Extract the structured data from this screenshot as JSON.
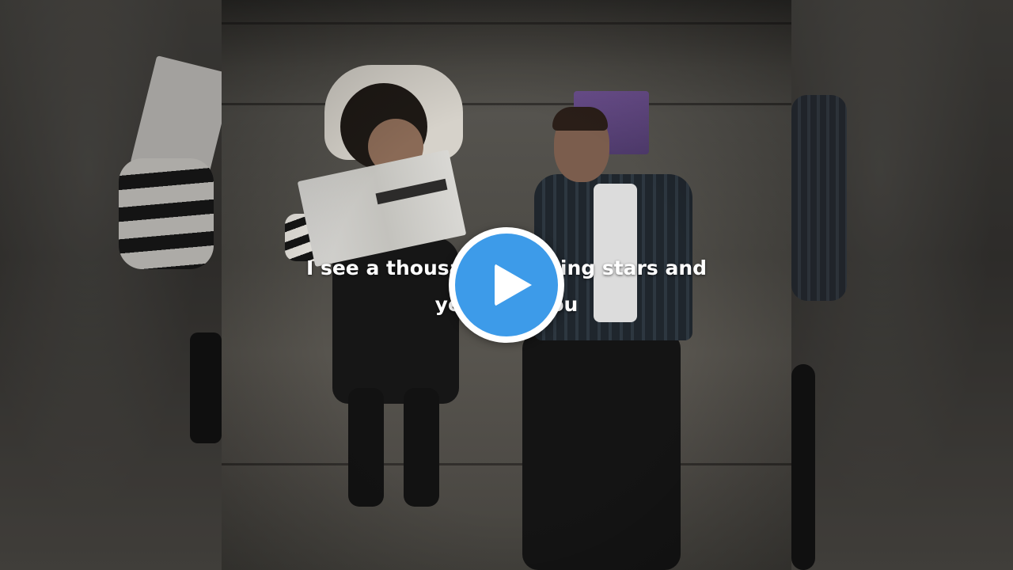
{
  "video": {
    "captions": {
      "line1": "I see a thousand shooting stars and",
      "line2": "yet I see you"
    },
    "accent_color": "#3d9be9"
  },
  "controls": {
    "play_icon": "play-icon"
  }
}
